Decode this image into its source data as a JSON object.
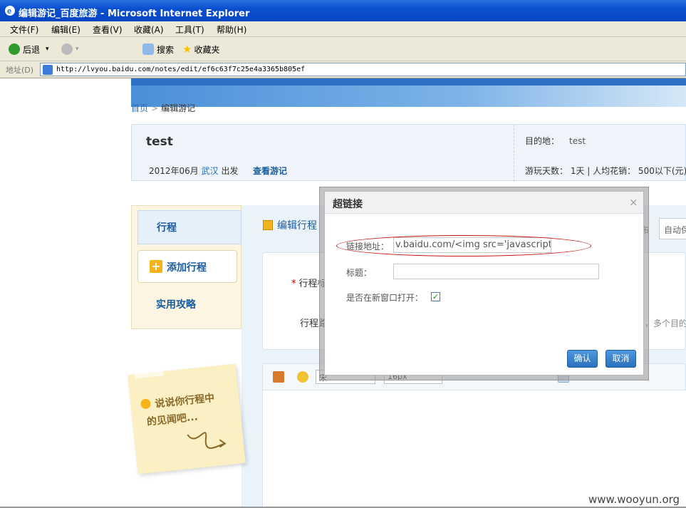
{
  "window": {
    "title": "编辑游记_百度旅游 - Microsoft Internet Explorer"
  },
  "menu": [
    "文件(F)",
    "编辑(E)",
    "查看(V)",
    "收藏(A)",
    "工具(T)",
    "帮助(H)"
  ],
  "toolbar": {
    "back": "后退",
    "search": "搜索",
    "favorites": "收藏夹"
  },
  "address": {
    "label": "地址(D)",
    "url": "http://lvyou.baidu.com/notes/edit/ef6c63f7c25e4a3365b805ef"
  },
  "breadcrumb": {
    "home": "首页",
    "sep": ">",
    "current": "编辑游记"
  },
  "note": {
    "title": "test",
    "date": "2012年06月",
    "city": "武汉",
    "depart": "出发",
    "view_link": "查看游记",
    "dest_label": "目的地：",
    "dest_value": "test",
    "days": "游玩天数： 1天 | 人均花销： 500以下(元)"
  },
  "tabs": {
    "itinerary": "行程",
    "add": "添加行程",
    "guide": "实用攻略"
  },
  "editor": {
    "header": "编辑行程",
    "publish": "布",
    "autosave": "自动保",
    "field1": "行程标",
    "field2": "行程路",
    "hint": "，多个目的地",
    "font_sel": "宋",
    "size_sel": "16px"
  },
  "sticky": {
    "line1": "说说你行程中",
    "line2": "的见闻吧..."
  },
  "dialog": {
    "title": "超链接",
    "close": "×",
    "url_label": "链接地址：",
    "url_value": "v.baidu.com/<img src='javascript:ale",
    "title_label": "标题：",
    "title_value": "",
    "newwin_label": "是否在新窗口打开：",
    "ok": "确认",
    "cancel": "取消"
  },
  "watermark": "www.wooyun.org"
}
